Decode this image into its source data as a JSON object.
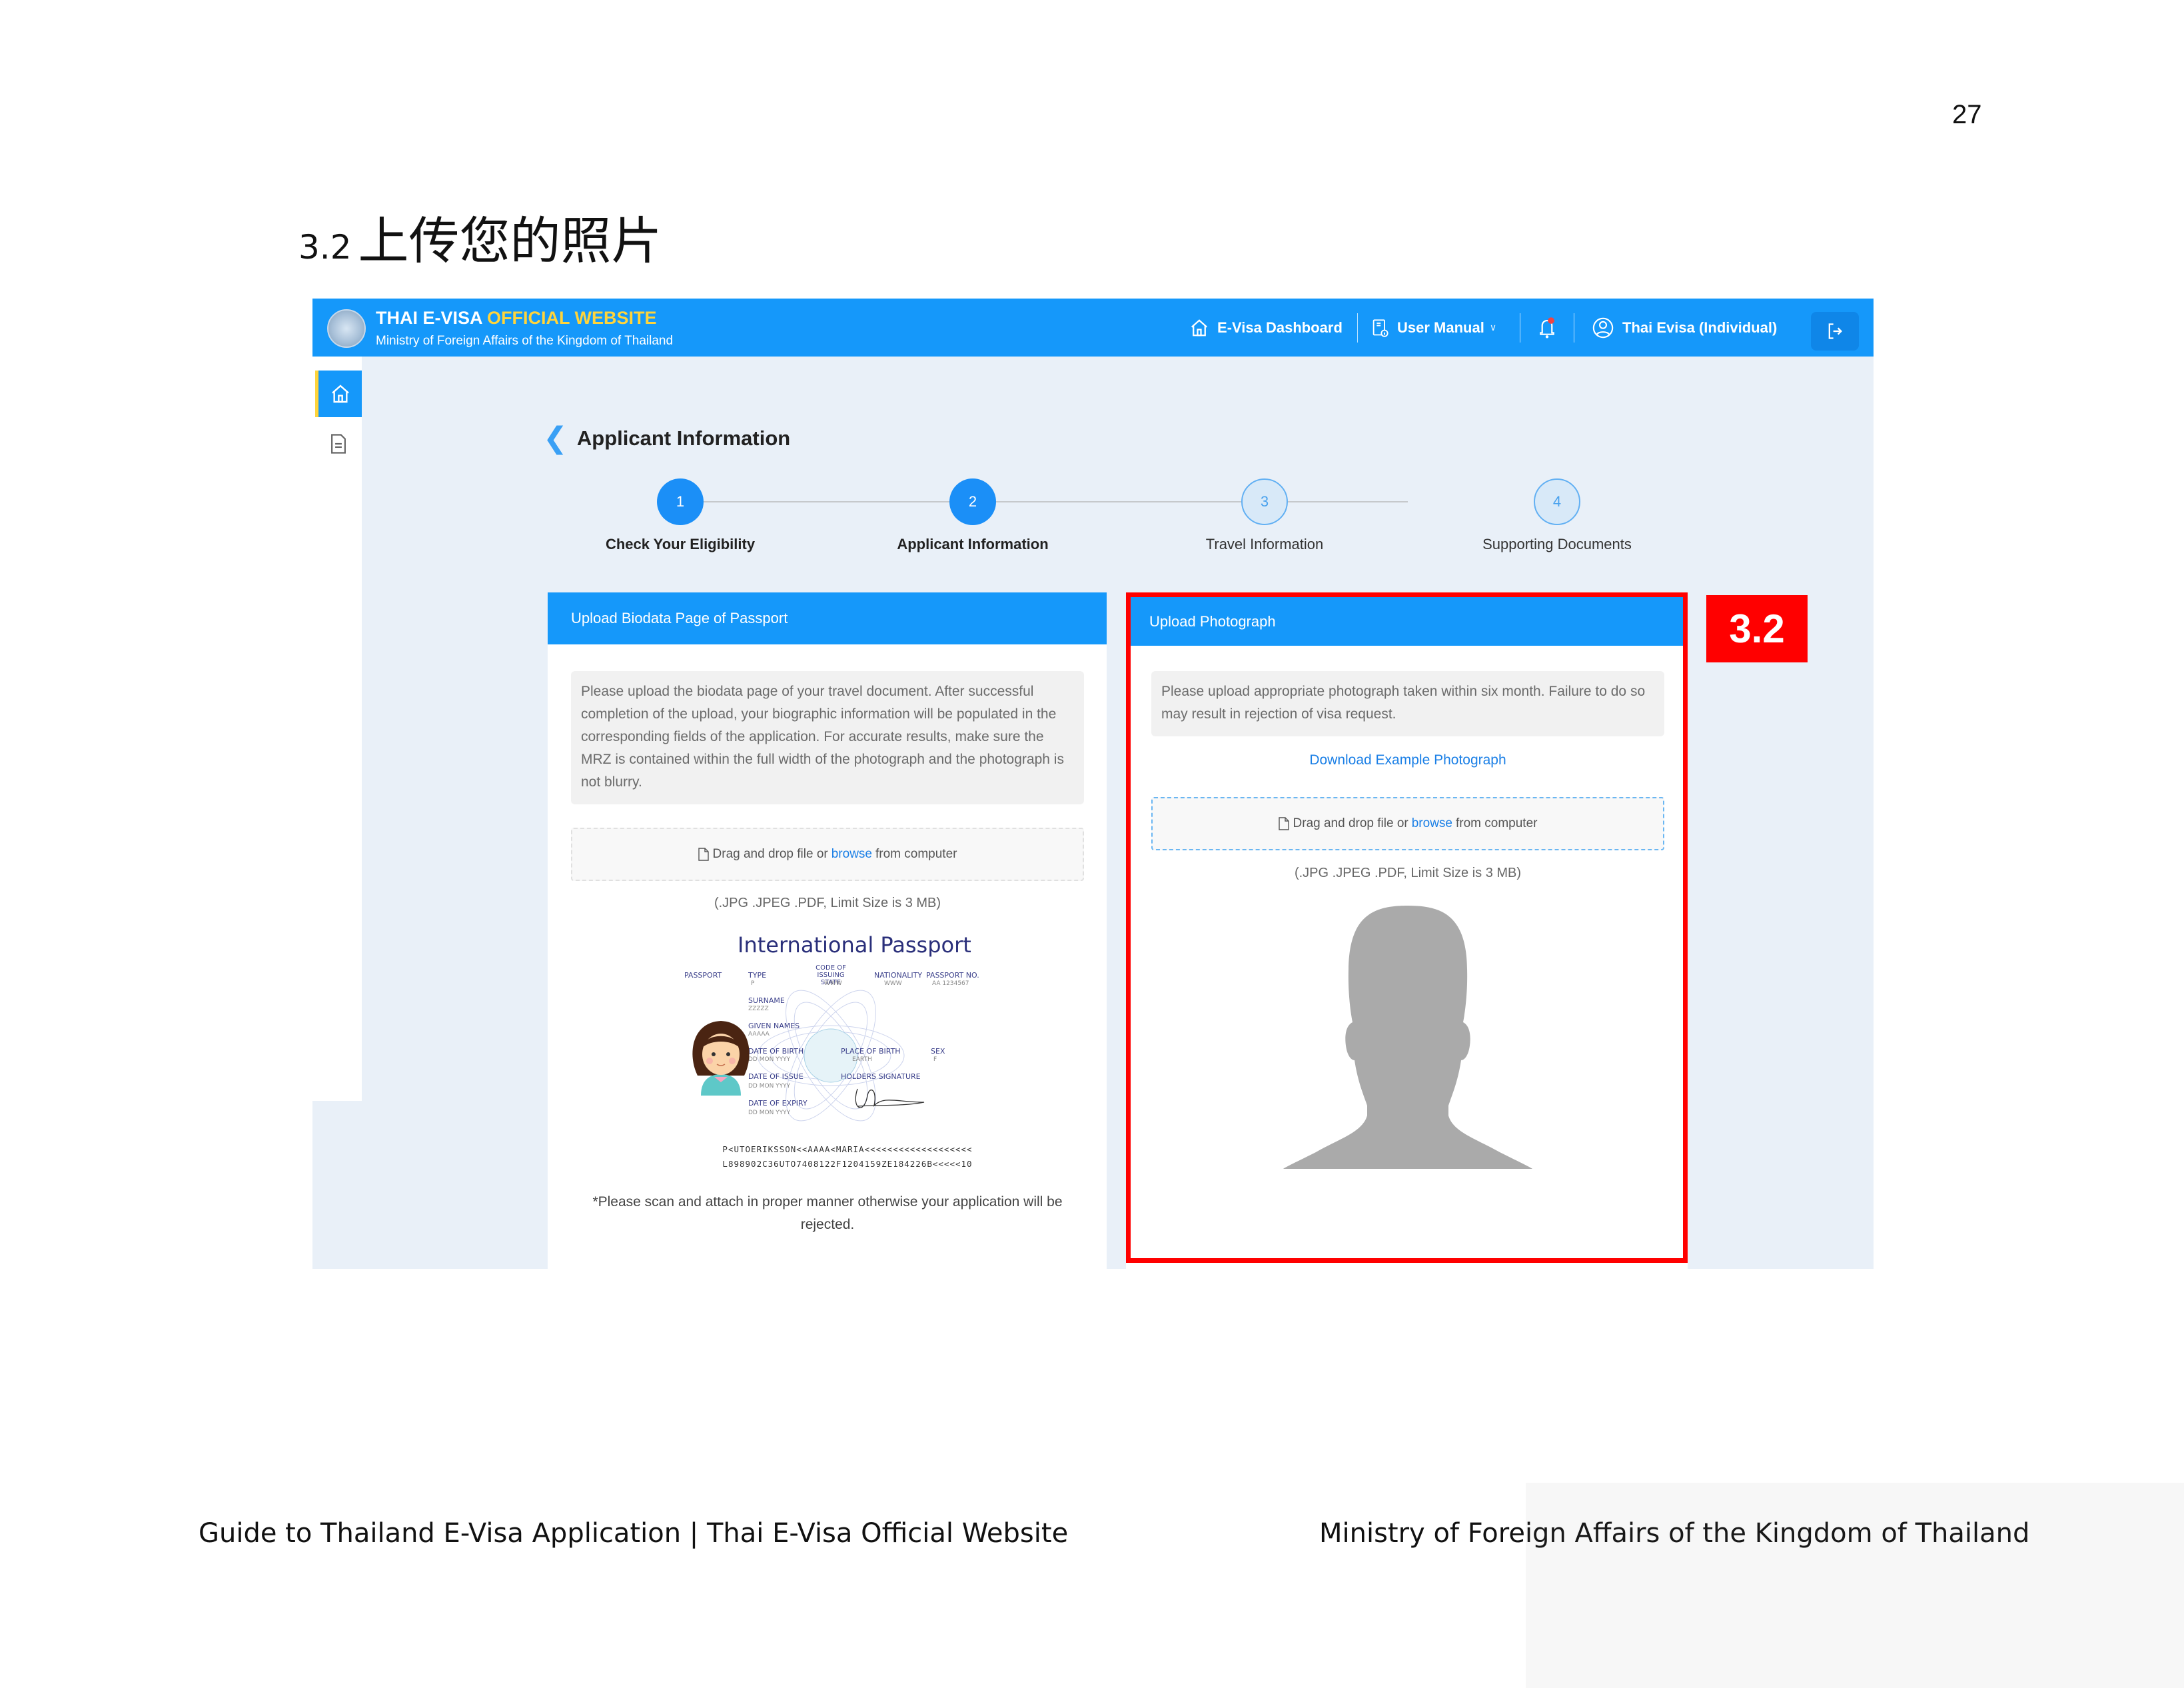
{
  "page": {
    "number": "27",
    "section_number": "3.2",
    "section_title": "上传您的照片",
    "footer_left": "Guide to Thailand E-Visa Application | Thai E-Visa Official Website",
    "footer_right": "Ministry of Foreign Affairs of the Kingdom of Thailand",
    "annotation_badge": "3.2",
    "annotation_color": "#ff0000"
  },
  "app": {
    "brand_title_white": "THAI E-VISA",
    "brand_title_yellow": "OFFICIAL WEBSITE",
    "brand_subtitle": "Ministry of Foreign Affairs of the Kingdom of Thailand",
    "colors": {
      "primary": "#1598fa",
      "highlight": "#ffd43b",
      "background": "#e9f0f8"
    },
    "nav": {
      "dashboard": "E-Visa Dashboard",
      "manual": "User Manual",
      "user": "Thai Evisa (Individual)",
      "notification_dot": true
    },
    "sidebar": [
      {
        "icon": "home-icon",
        "active": true
      },
      {
        "icon": "document-icon",
        "active": false
      }
    ]
  },
  "main": {
    "back_title": "Applicant Information",
    "steps": [
      {
        "number": "1",
        "label": "Check Your Eligibility",
        "state": "done"
      },
      {
        "number": "2",
        "label": "Applicant Information",
        "state": "done"
      },
      {
        "number": "3",
        "label": "Travel Information",
        "state": "todo"
      },
      {
        "number": "4",
        "label": "Supporting Documents",
        "state": "todo"
      }
    ],
    "passport_card": {
      "title": "Upload Biodata Page of Passport",
      "info": "Please upload the biodata page of your travel document. After successful completion of the upload, your biographic information will be populated in the corresponding fields of the application. For accurate results, make sure the MRZ is contained within the full width of the photograph and the photograph is not blurry.",
      "drop_before": "Drag and drop file or",
      "drop_link": "browse",
      "drop_after": "from computer",
      "limits": "(.JPG .JPEG .PDF, Limit Size is 3 MB)",
      "sample": {
        "title": "International Passport",
        "labels": {
          "passport": "PASSPORT",
          "type": "TYPE",
          "type_val": "P",
          "code": "CODE OF ISSUING STATE",
          "code_val": "WWW",
          "nationality": "NATIONALITY",
          "nationality_val": "WWW",
          "passport_no": "PASSPORT NO.",
          "passport_no_val": "AA 1234567",
          "surname": "SURNAME",
          "surname_val": "ZZZZZ",
          "given": "GIVEN NAMES",
          "given_val": "AAAAA",
          "dob": "DATE OF BIRTH",
          "dob_val": "DD MON YYYY",
          "pob": "PLACE OF BIRTH",
          "pob_val": "EARTH",
          "sex": "SEX",
          "sex_val": "F",
          "issue": "DATE OF ISSUE",
          "issue_val": "DD MON YYYY",
          "signature": "HOLDERS SIGNATURE",
          "expiry": "DATE OF EXPIRY",
          "expiry_val": "DD MON YYYY"
        },
        "mrz_line1": "P<UTOERIKSSON<<AAAA<MARIA<<<<<<<<<<<<<<<<<<<",
        "mrz_line2": "L898902C36UTO7408122F1204159ZE184226B<<<<<10"
      },
      "note": "*Please scan and attach in proper manner otherwise your application will be rejected."
    },
    "photo_card": {
      "title": "Upload Photograph",
      "info": "Please upload appropriate photograph taken within six month. Failure to do so may result in rejection of visa request.",
      "download_link": "Download Example Photograph",
      "drop_before": "Drag and drop file or",
      "drop_link": "browse",
      "drop_after": "from computer",
      "limits": "(.JPG .JPEG .PDF, Limit Size is 3 MB)"
    }
  }
}
